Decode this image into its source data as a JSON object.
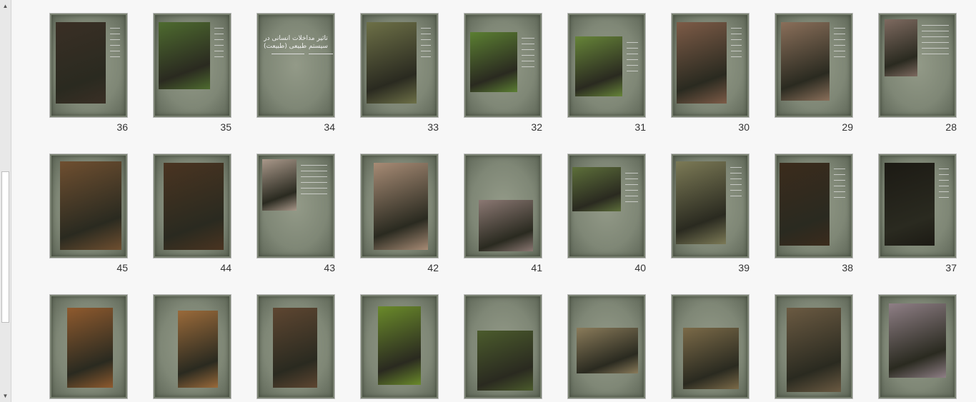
{
  "scrollbar": {
    "up": "▲",
    "down": "▼"
  },
  "title34": "تاثیر مداخلات انسانی در سیستم طبیعی (طبیعت)",
  "slides": [
    {
      "n": "36",
      "photo": "#3a2f25"
    },
    {
      "n": "35",
      "photo": "#4e6b2f"
    },
    {
      "n": "34",
      "photo": ""
    },
    {
      "n": "33",
      "photo": "#6d7047"
    },
    {
      "n": "32",
      "photo": "#5b7f32"
    },
    {
      "n": "31",
      "photo": "#668438"
    },
    {
      "n": "30",
      "photo": "#7d5b47"
    },
    {
      "n": "29",
      "photo": "#8a6f5a"
    },
    {
      "n": "28",
      "photo": "#7e6a60"
    },
    {
      "n": "45",
      "photo": "#6f4f30"
    },
    {
      "n": "44",
      "photo": "#4a3421"
    },
    {
      "n": "43",
      "photo": "#a9988a"
    },
    {
      "n": "42",
      "photo": "#a78b75"
    },
    {
      "n": "41",
      "photo": "#8b7873"
    },
    {
      "n": "40",
      "photo": "#5d6f3a"
    },
    {
      "n": "39",
      "photo": "#7c7a56"
    },
    {
      "n": "38",
      "photo": "#3b2b1c"
    },
    {
      "n": "37",
      "photo": "#1c1a14"
    },
    {
      "n": "",
      "photo": "#8f5a2e"
    },
    {
      "n": "",
      "photo": "#9a6a3a"
    },
    {
      "n": "",
      "photo": "#5e4631"
    },
    {
      "n": "",
      "photo": "#6a8a2a"
    },
    {
      "n": "",
      "photo": "#4b5b2c"
    },
    {
      "n": "",
      "photo": "#8a7b5a"
    },
    {
      "n": "",
      "photo": "#7b6a48"
    },
    {
      "n": "",
      "photo": "#6b5a42"
    },
    {
      "n": "",
      "photo": "#8f7f86"
    }
  ]
}
